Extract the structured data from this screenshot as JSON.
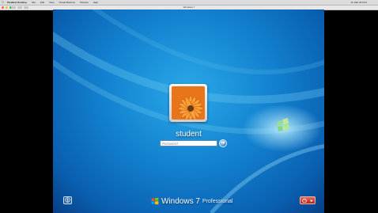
{
  "mac_menubar": {
    "app_name": "Parallels Desktop",
    "menus": [
      "File",
      "Edit",
      "View",
      "Virtual Machine",
      "Window",
      "Help"
    ],
    "clock": "Fri Mar 30 9:01"
  },
  "window": {
    "title": "Windows 7"
  },
  "login": {
    "username": "student",
    "password_placeholder": "Password",
    "go_symbol": "➜"
  },
  "footer": {
    "brand_name": "Windows 7",
    "edition": "Professional",
    "ease_of_access_icon": "ease-of-access-icon",
    "shutdown_icon": "power-icon"
  },
  "colors": {
    "background_blue": "#1281cf",
    "shutdown_red": "#c0392b"
  }
}
